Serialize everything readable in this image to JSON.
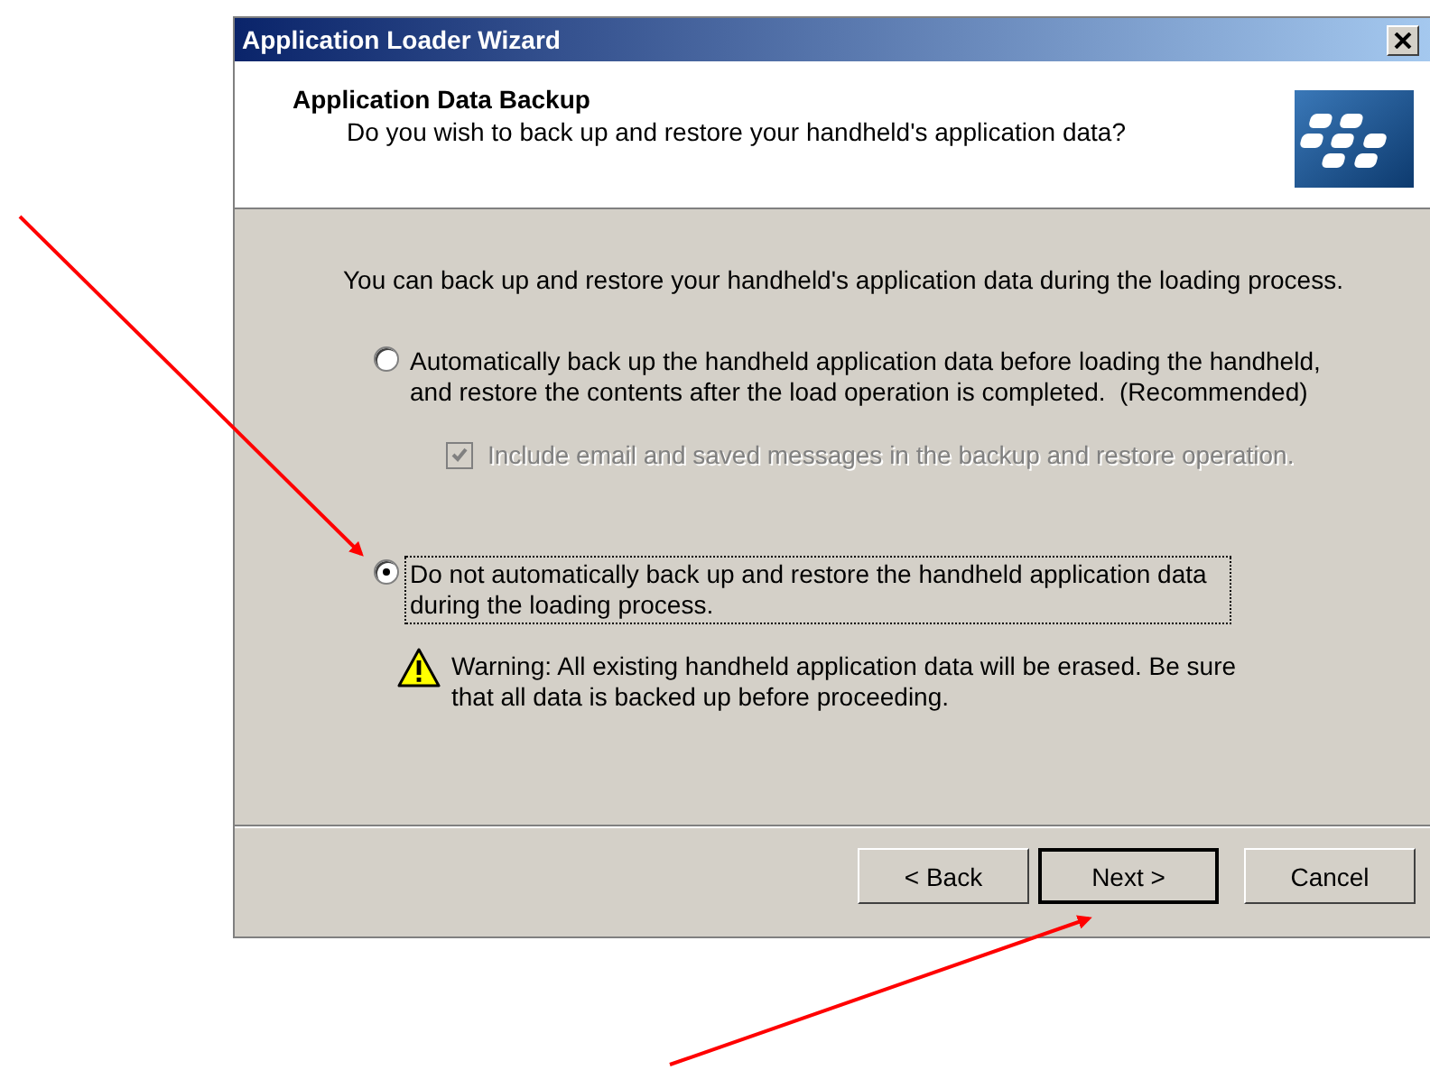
{
  "window": {
    "title": "Application Loader Wizard"
  },
  "header": {
    "title": "Application Data Backup",
    "subtitle": "Do you wish to back up and restore your handheld's application data?"
  },
  "intro": "You can back up and restore your handheld's application data during the loading process.",
  "options": [
    {
      "label": "Automatically back up the handheld application data before loading the handheld, and restore the contents after the load operation is completed.  (Recommended)",
      "selected": false,
      "focused": false,
      "sub_option": {
        "label": "Include email and saved messages in the backup and restore operation.",
        "checked": true,
        "disabled": true
      }
    },
    {
      "label": "Do not automatically back up and restore the handheld application data during the loading process.",
      "selected": true,
      "focused": true
    }
  ],
  "warning": "Warning: All existing handheld application data will be erased. Be sure that all data is backed up before proceeding.",
  "buttons": [
    {
      "label": "< Back",
      "default": false
    },
    {
      "label": "Next >",
      "default": true
    },
    {
      "label": "Cancel",
      "default": false
    }
  ]
}
